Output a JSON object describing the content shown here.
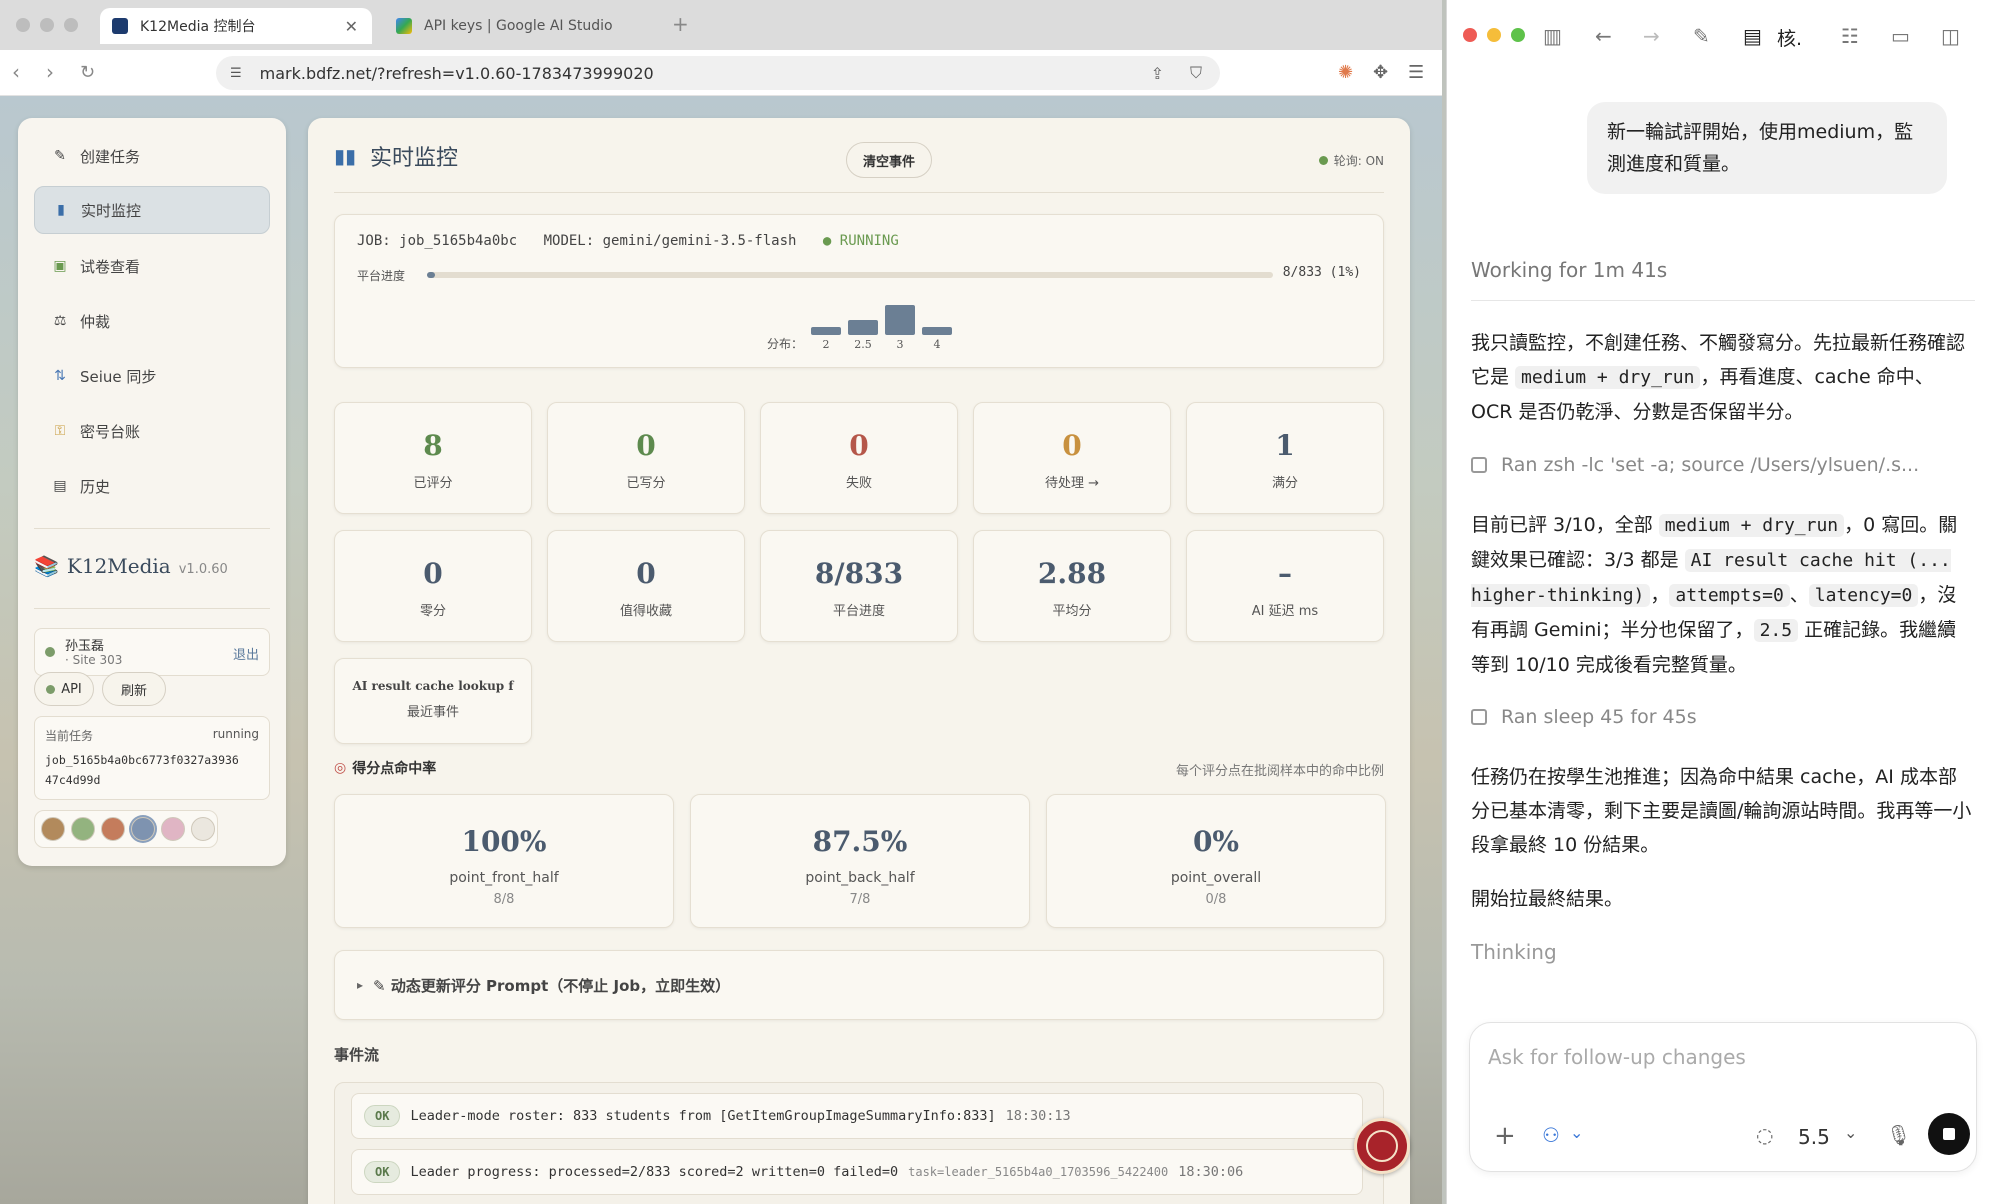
{
  "browser": {
    "tabs": [
      {
        "title": "K12Media 控制台",
        "active": true
      },
      {
        "title": "API keys | Google AI Studio",
        "active": false
      }
    ],
    "new_tab": "+",
    "url": "mark.bdfz.net/?refresh=v1.0.60-1783473999020"
  },
  "sidebar": {
    "nav": [
      {
        "icon": "memo-icon",
        "label": "创建任务"
      },
      {
        "icon": "bar-chart-icon",
        "label": "实时监控"
      },
      {
        "icon": "picture-icon",
        "label": "试卷查看"
      },
      {
        "icon": "scales-icon",
        "label": "仲裁"
      },
      {
        "icon": "sync-icon",
        "label": "Seiue 同步"
      },
      {
        "icon": "key-icon",
        "label": "密号台账"
      },
      {
        "icon": "history-icon",
        "label": "历史"
      }
    ],
    "brand": "K12Media",
    "version": "v1.0.60",
    "user": {
      "name": "孙玉磊",
      "site": "· Site 303",
      "logout": "退出"
    },
    "api_label": "API",
    "refresh_label": "刷新",
    "current_task": {
      "label": "当前任务",
      "status": "running",
      "id_line1": "job_5165b4a0bc6773f0327a3936",
      "id_line2": "47c4d99d"
    },
    "theme_colors": [
      "#b28a5c",
      "#93b37f",
      "#c47c5c",
      "#7e93b0",
      "#e0b5c4",
      "#ebe7df"
    ]
  },
  "main": {
    "title": "实时监控",
    "clear_button": "清空事件",
    "polling": "轮询: ON",
    "job": {
      "job_label": "JOB: job_5165b4a0bc",
      "model_label": "MODEL: gemini/gemini-3.5-flash",
      "status": "RUNNING",
      "progress_label": "平台进度",
      "progress_text": "8/833 (1%)",
      "progress_fraction": 0.0096,
      "dist_label": "分布：",
      "dist": [
        {
          "score": "2",
          "count": 1
        },
        {
          "score": "2.5",
          "count": 2
        },
        {
          "score": "3",
          "count": 4
        },
        {
          "score": "4",
          "count": 1
        }
      ]
    },
    "stats_row1": [
      {
        "value": "8",
        "label": "已评分",
        "color": "#5d8a4e"
      },
      {
        "value": "0",
        "label": "已写分",
        "color": "#5d8a4e"
      },
      {
        "value": "0",
        "label": "失败",
        "color": "#b5574a"
      },
      {
        "value": "0",
        "label": "待处理 →",
        "color": "#c8913f"
      },
      {
        "value": "1",
        "label": "满分",
        "color": "#4b5b6e"
      }
    ],
    "stats_row2": [
      {
        "value": "0",
        "label": "零分",
        "color": "#4b5b6e"
      },
      {
        "value": "0",
        "label": "值得收藏",
        "color": "#4b5b6e"
      },
      {
        "value": "8/833",
        "label": "平台进度",
        "color": "#4b5b6e"
      },
      {
        "value": "2.88",
        "label": "平均分",
        "color": "#4b5b6e"
      },
      {
        "value": "–",
        "label": "AI 延迟 ms",
        "color": "#4b5b6e"
      }
    ],
    "recent_event": {
      "text": "AI result cache lookup f",
      "label": "最近事件"
    },
    "hit_rate": {
      "title": "得分点命中率",
      "note": "每个评分点在批阅样本中的命中比例",
      "items": [
        {
          "value": "100%",
          "name": "point_front_half",
          "sub": "8/8"
        },
        {
          "value": "87.5%",
          "name": "point_back_half",
          "sub": "7/8"
        },
        {
          "value": "0%",
          "name": "point_overall",
          "sub": "0/8"
        }
      ]
    },
    "prompt_update": "✎ 动态更新评分 Prompt（不停止 Job，立即生效）",
    "event_stream": {
      "title": "事件流",
      "events": [
        {
          "tag": "OK",
          "text": "Leader-mode roster: 833 students from [GetItemGroupImageSummaryInfo:833]",
          "meta": "",
          "time": "18:30:13"
        },
        {
          "tag": "OK",
          "text": "Leader progress: processed=2/833 scored=2 written=0 failed=0",
          "meta": "task=leader_5165b4a0_1703596_5422400",
          "time": "18:30:06"
        }
      ]
    }
  },
  "chat": {
    "toolbar_title": "核.",
    "user_message": "新一輪試評開始，使用medium，監測進度和質量。",
    "working": "Working for 1m 41s",
    "para1_a": "我只讀監控，不創建任務、不觸發寫分。先拉最新任務確認它是 ",
    "para1_code": "medium + dry_run",
    "para1_b": "，再看進度、cache 命中、OCR 是否仍乾淨、分數是否保留半分。",
    "cmd1": "Ran zsh -lc 'set -a; source /Users/ylsuen/.s...",
    "para2_a": "目前已評 3/10，全部 ",
    "para2_code1": "medium + dry_run",
    "para2_b": "，0 寫回。關鍵效果已確認：3/3 都是 ",
    "para2_code2": "AI result cache hit (... higher-thinking)",
    "para2_c": "，",
    "para2_code3": "attempts=0",
    "para2_d": "、",
    "para2_code4": "latency=0",
    "para2_e": "，沒有再調 Gemini；半分也保留了，",
    "para2_code5": "2.5",
    "para2_f": " 正確記錄。我繼續等到 10/10 完成後看完整質量。",
    "cmd2": "Ran sleep 45 for 45s",
    "para3": "任務仍在按學生池推進；因為命中結果 cache，AI 成本部分已基本清零，剩下主要是讀圖/輪詢源站時間。我再等一小段拿最終 10 份結果。",
    "para4": "開始拉最終結果。",
    "thinking": "Thinking",
    "input_placeholder": "Ask for follow-up changes",
    "model_version": "5.5"
  }
}
